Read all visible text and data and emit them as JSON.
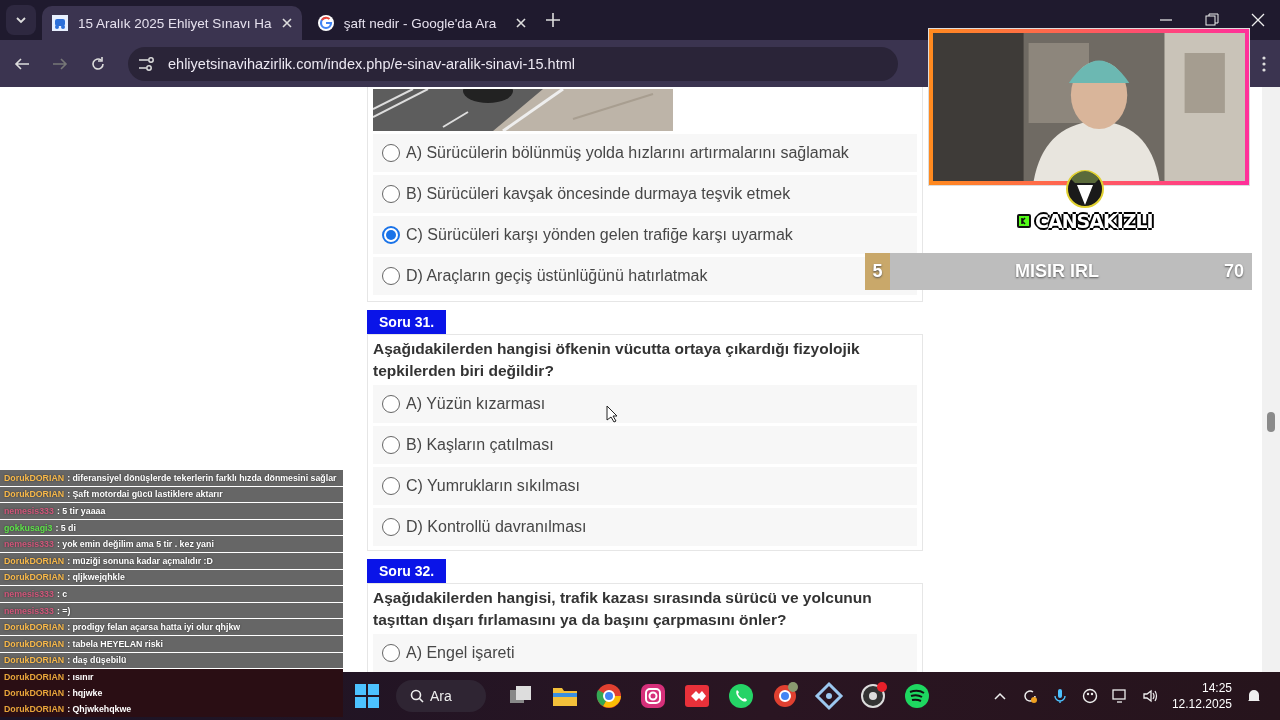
{
  "browser": {
    "tabs": [
      {
        "title": "15 Aralık 2025 Ehliyet Sınavı Ha",
        "selected": true
      },
      {
        "title": "şaft nedir - Google'da Ara",
        "selected": false
      }
    ],
    "url": "ehliyetsinavihazirlik.com/index.php/e-sinav-aralik-sinavi-15.html"
  },
  "questions": [
    {
      "options": [
        {
          "label": "A) Sürücülerin bölünmüş yolda hızlarını artırmalarını sağlamak",
          "selected": false
        },
        {
          "label": "B) Sürücüleri kavşak öncesinde durmaya teşvik etmek",
          "selected": false
        },
        {
          "label": "C) Sürücüleri karşı yönden gelen trafiğe karşı uyarmak",
          "selected": true
        },
        {
          "label": "D) Araçların geçiş üstünlüğünü hatırlatmak",
          "selected": false
        }
      ]
    },
    {
      "number": "Soru 31.",
      "text": "Aşağıdakilerden hangisi öfkenin vücutta ortaya çıkardığı fizyolojik tepkilerden biri değildir?",
      "options": [
        {
          "label": "A) Yüzün kızarması",
          "selected": false
        },
        {
          "label": "B) Kaşların çatılması",
          "selected": false
        },
        {
          "label": "C) Yumrukların sıkılması",
          "selected": false
        },
        {
          "label": "D) Kontrollü davranılması",
          "selected": false
        }
      ]
    },
    {
      "number": "Soru 32.",
      "text": "Aşağıdakilerden hangisi, trafik kazası sırasında sürücü ve yolcunun taşıttan dışarı fırlamasını ya da başını çarpmasını önler?",
      "options": [
        {
          "label": "A) Engel işareti",
          "selected": false
        }
      ]
    }
  ],
  "overlay": {
    "streamer": "CANSAKIZLI",
    "bar": {
      "rank": "5",
      "title": "MISIR IRL",
      "count": "70"
    }
  },
  "chat": [
    {
      "user": "DorukDORIAN",
      "message": ": diferansiyel dönüşlerde tekerlerin farklı hızda dönmesini sağlar",
      "color": "#f7b84a",
      "highlight": false
    },
    {
      "user": "DorukDORIAN",
      "message": ": Şaft motordai gücü lastiklere aktarır",
      "color": "#f7b84a",
      "highlight": false
    },
    {
      "user": "nemesis333",
      "message": ": 5 tir yaaaa",
      "color": "#d0567a",
      "highlight": false
    },
    {
      "user": "gokkusagi3",
      "message": ": 5 di",
      "color": "#5ee04a",
      "highlight": false
    },
    {
      "user": "nemesis333",
      "message": ": yok emin değilim ama 5 tir . kez yani",
      "color": "#d0567a",
      "highlight": false
    },
    {
      "user": "DorukDORIAN",
      "message": ": müziği sonuna kadar açmalıdır :D",
      "color": "#f7b84a",
      "highlight": false
    },
    {
      "user": "DorukDORIAN",
      "message": ": qljkwejqhkle",
      "color": "#f7b84a",
      "highlight": false
    },
    {
      "user": "nemesis333",
      "message": ": c",
      "color": "#d0567a",
      "highlight": false
    },
    {
      "user": "nemesis333",
      "message": ": =)",
      "color": "#d0567a",
      "highlight": false
    },
    {
      "user": "DorukDORIAN",
      "message": ": prodigy felan açarsa hatta iyi olur qhjkw",
      "color": "#f7b84a",
      "highlight": false
    },
    {
      "user": "DorukDORIAN",
      "message": ": tabela HEYELAN riski",
      "color": "#f7b84a",
      "highlight": false
    },
    {
      "user": "DorukDORIAN",
      "message": ": daş düşebilü",
      "color": "#f7b84a",
      "highlight": false
    },
    {
      "user": "DorukDORIAN",
      "message": ": ısınır",
      "color": "#e8a53a",
      "highlight": true
    },
    {
      "user": "DorukDORIAN",
      "message": ": hqjwke",
      "color": "#e8a53a",
      "highlight": true
    },
    {
      "user": "DorukDORIAN",
      "message": ": Qhjwkehqkwe",
      "color": "#e8a53a",
      "highlight": true
    }
  ],
  "taskbar": {
    "search": "Ara",
    "time": "14:25",
    "date": "12.12.2025"
  }
}
